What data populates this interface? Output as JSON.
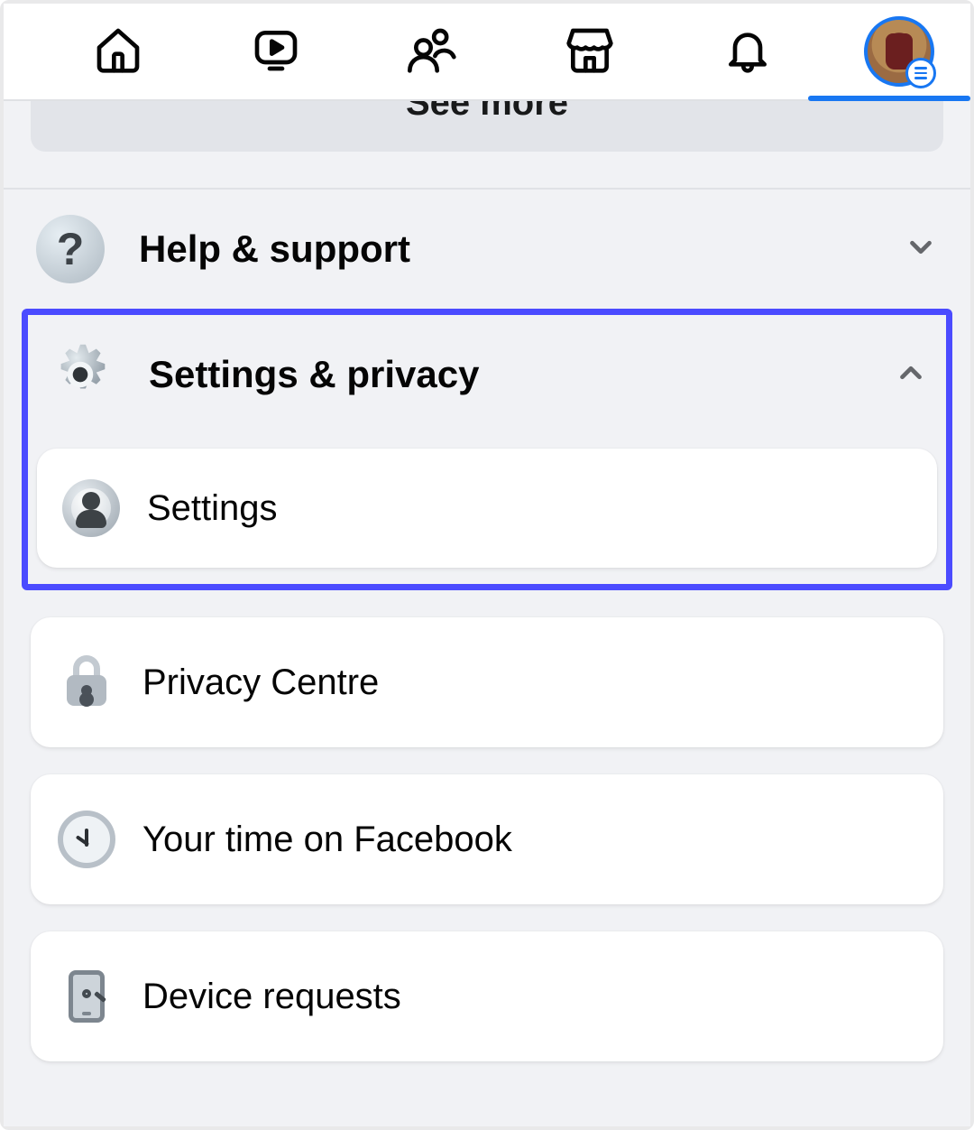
{
  "see_more_label": "See more",
  "help_support": {
    "label": "Help & support"
  },
  "settings_privacy": {
    "label": "Settings & privacy",
    "items": [
      {
        "label": "Settings"
      },
      {
        "label": "Privacy Centre"
      },
      {
        "label": "Your time on Facebook"
      },
      {
        "label": "Device requests"
      }
    ]
  }
}
